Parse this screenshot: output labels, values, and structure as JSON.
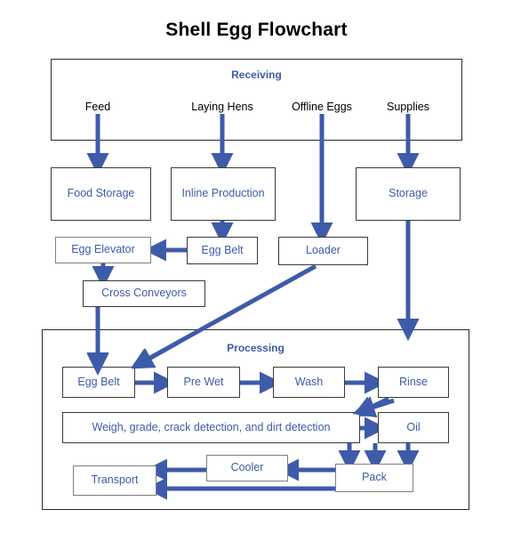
{
  "title": "Shell Egg Flowchart",
  "colors": {
    "arrow": "#3d5ba9",
    "node_text": "#3d5ba9",
    "group_label": "#3d5ba9",
    "box_border": "#3a3a3a",
    "title_text": "#000000",
    "background": "#ffffff"
  },
  "groups": [
    {
      "id": "receiving",
      "label": "Receiving"
    },
    {
      "id": "processing",
      "label": "Processing"
    }
  ],
  "receiving_inputs": [
    {
      "id": "feed",
      "label": "Feed"
    },
    {
      "id": "laying-hens",
      "label": "Laying Hens"
    },
    {
      "id": "offline-eggs",
      "label": "Offline Eggs"
    },
    {
      "id": "supplies",
      "label": "Supplies"
    }
  ],
  "nodes": [
    {
      "id": "food-storage",
      "label": "Food Storage"
    },
    {
      "id": "inline-production",
      "label": "Inline Production"
    },
    {
      "id": "storage",
      "label": "Storage"
    },
    {
      "id": "egg-elevator",
      "label": "Egg Elevator"
    },
    {
      "id": "egg-belt-upper",
      "label": "Egg Belt"
    },
    {
      "id": "loader",
      "label": "Loader"
    },
    {
      "id": "cross-conveyors",
      "label": "Cross Conveyors"
    },
    {
      "id": "egg-belt-processing",
      "label": "Egg Belt"
    },
    {
      "id": "pre-wet",
      "label": "Pre Wet"
    },
    {
      "id": "wash",
      "label": "Wash"
    },
    {
      "id": "rinse",
      "label": "Rinse"
    },
    {
      "id": "weigh-grade",
      "label": "Weigh, grade, crack detection, and dirt detection"
    },
    {
      "id": "oil",
      "label": "Oil"
    },
    {
      "id": "pack",
      "label": "Pack"
    },
    {
      "id": "cooler",
      "label": "Cooler"
    },
    {
      "id": "transport",
      "label": "Transport"
    }
  ],
  "flows": [
    {
      "from": "feed",
      "to": "food-storage"
    },
    {
      "from": "laying-hens",
      "to": "inline-production"
    },
    {
      "from": "offline-eggs",
      "to": "loader"
    },
    {
      "from": "supplies",
      "to": "storage"
    },
    {
      "from": "inline-production",
      "to": "egg-belt-upper"
    },
    {
      "from": "egg-belt-upper",
      "to": "egg-elevator"
    },
    {
      "from": "egg-elevator",
      "to": "cross-conveyors"
    },
    {
      "from": "cross-conveyors",
      "to": "egg-belt-processing"
    },
    {
      "from": "loader",
      "to": "egg-belt-processing"
    },
    {
      "from": "storage",
      "to": "pack"
    },
    {
      "from": "egg-belt-processing",
      "to": "pre-wet"
    },
    {
      "from": "pre-wet",
      "to": "wash"
    },
    {
      "from": "wash",
      "to": "rinse"
    },
    {
      "from": "rinse",
      "to": "weigh-grade"
    },
    {
      "from": "weigh-grade",
      "to": "oil"
    },
    {
      "from": "weigh-grade",
      "to": "pack"
    },
    {
      "from": "oil",
      "to": "pack"
    },
    {
      "from": "pack",
      "to": "cooler"
    },
    {
      "from": "cooler",
      "to": "transport"
    },
    {
      "from": "pack",
      "to": "transport"
    }
  ],
  "chart_data": {
    "type": "diagram",
    "title": "Shell Egg Flowchart",
    "layout": "top-to-bottom process flow with two grouping containers"
  }
}
